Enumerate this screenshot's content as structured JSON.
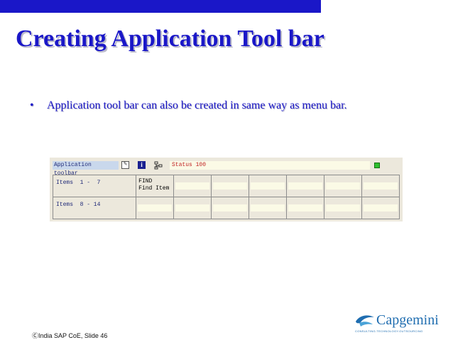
{
  "slide": {
    "title": "Creating Application Tool bar",
    "bullet_symbol": "•",
    "bullet_text": "Application tool bar can also be created in same way as menu bar.",
    "footer": "ⒸIndia SAP CoE, Slide 46"
  },
  "sap_screen": {
    "toolbar_label": "Application toolbar",
    "status_text": "Status 100",
    "info_icon_glyph": "i",
    "status_light_color": "#2fc02f",
    "rows": [
      {
        "label": "Items  1 -  7",
        "first_cell_line1": "FIND",
        "first_cell_line2": "Find Item"
      },
      {
        "label": "Items  8 - 14"
      }
    ]
  },
  "logo": {
    "name": "Capgemini",
    "tagline": "CONSULTING.TECHNOLOGY.OUTSOURCING"
  },
  "colors": {
    "accent_blue": "#1a17c8",
    "logo_blue": "#1f6db0"
  },
  "icons": [
    "edit-icon",
    "info-icon",
    "hierarchy-icon",
    "green-status-icon",
    "capgemini-spade-icon"
  ]
}
